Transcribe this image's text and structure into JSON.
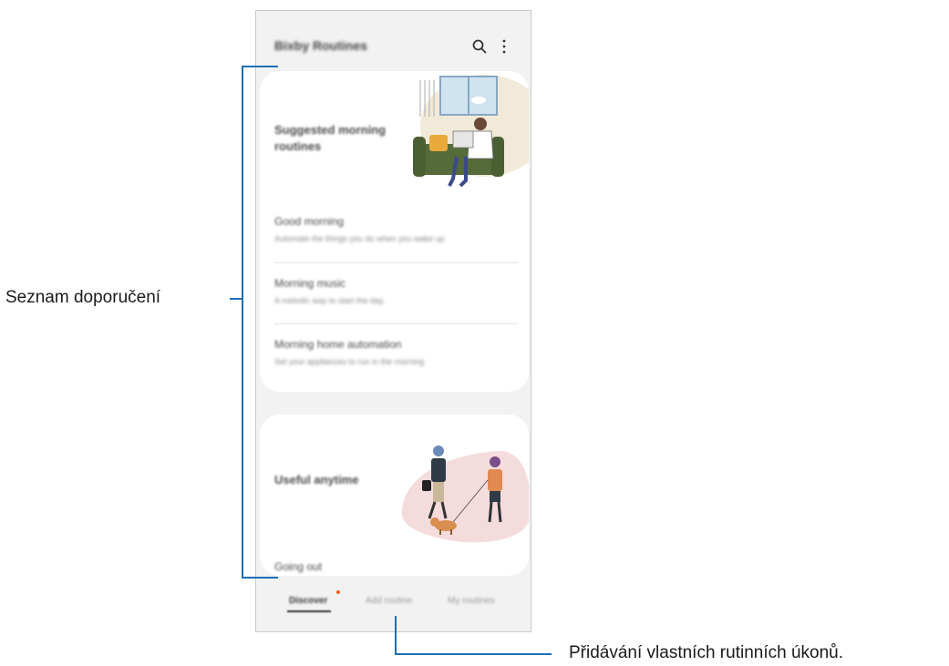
{
  "app": {
    "title": "Bixby Routines",
    "actions": [
      "search-icon",
      "more-options-icon"
    ]
  },
  "discover": {
    "card1": {
      "heading": "Suggested morning routines",
      "routines": [
        {
          "name": "Good morning",
          "description": "Automate the things you do when you wake up"
        },
        {
          "name": "Morning music",
          "description": "A melodic way to start the day."
        },
        {
          "name": "Morning home automation",
          "description": "Set your appliances to run in the morning"
        }
      ]
    },
    "card2": {
      "heading": "Useful anytime",
      "items": [
        "Going out"
      ]
    }
  },
  "nav": {
    "tabs": [
      {
        "label": "Discover",
        "active": true
      },
      {
        "label": "Add routine",
        "active": false
      },
      {
        "label": "My routines",
        "active": false
      }
    ],
    "badge_color": "#e8601c"
  },
  "callouts": {
    "left_label": "Seznam doporučení",
    "bottom_label": "Přidávání vlastních rutinních úkonů.",
    "line_color": "#1b6fb3"
  }
}
